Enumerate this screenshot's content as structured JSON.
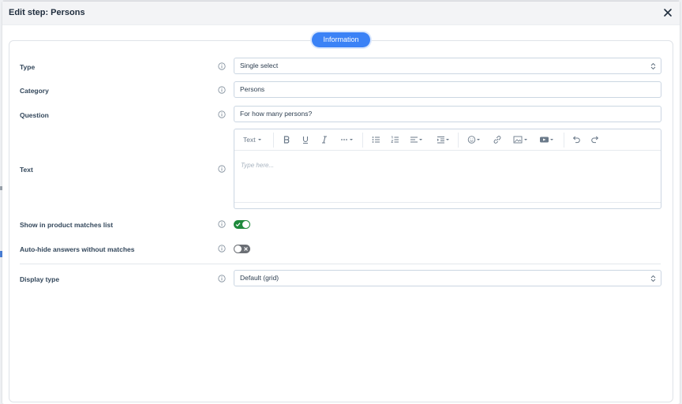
{
  "modal": {
    "title": "Edit step: Persons"
  },
  "tabs": [
    {
      "label": "Information",
      "active": true
    }
  ],
  "form": {
    "type": {
      "label": "Type",
      "value": "Single select"
    },
    "category": {
      "label": "Category",
      "value": "Persons"
    },
    "question": {
      "label": "Question",
      "value": "For how many persons?"
    },
    "text": {
      "label": "Text",
      "placeholder": "Type here...",
      "toolbar": {
        "text_style_label": "Text",
        "buttons": [
          "bold-icon",
          "underline-icon",
          "italic-icon",
          "more-formatting-icon",
          "bulleted-list-icon",
          "numbered-list-icon",
          "align-icon",
          "indent-icon",
          "emoji-icon",
          "link-icon",
          "image-icon",
          "video-icon",
          "undo-icon",
          "redo-icon"
        ]
      }
    },
    "show_in_matches": {
      "label": "Show in product matches list",
      "enabled": true
    },
    "auto_hide": {
      "label": "Auto-hide answers without matches",
      "enabled": false
    },
    "display_type": {
      "label": "Display type",
      "value": "Default (grid)"
    }
  },
  "colors": {
    "accent": "#3b82f6",
    "toggle_on": "#1f8a3c",
    "toggle_off": "#6b6f75"
  }
}
